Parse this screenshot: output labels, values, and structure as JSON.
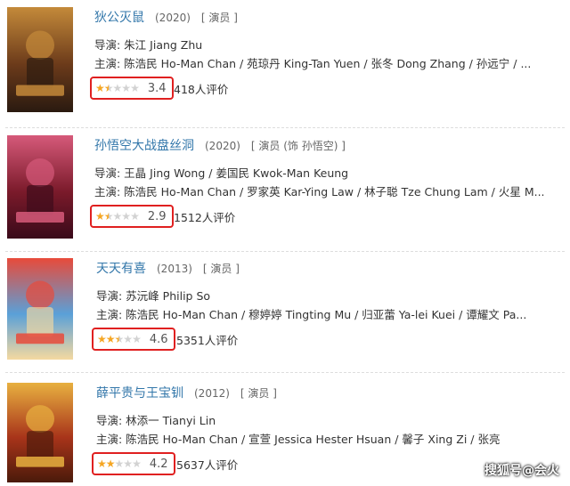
{
  "movies": [
    {
      "title": "狄公灭鼠",
      "year": "(2020)",
      "role": "[ 演员 ]",
      "director_line": "导演: 朱江 Jiang Zhu",
      "cast_line": "主演: 陈浩民 Ho-Man Chan / 苑琼丹 King-Tan Yuen / 张冬 Dong Zhang / 孙远宁 / ...",
      "score": "3.4",
      "rating_fraction": 0.34,
      "count": "418人评价",
      "poster_colors": [
        "#6b3a1a",
        "#c48a3a",
        "#2a1a10"
      ]
    },
    {
      "title": "孙悟空大战盘丝洞",
      "year": "(2020)",
      "role": "[ 演员 (饰 孙悟空) ]",
      "director_line": "导演: 王晶 Jing Wong / 姜国民 Kwok-Man Keung",
      "cast_line": "主演: 陈浩民 Ho-Man Chan / 罗家英 Kar-Ying Law / 林子聪 Tze Chung Lam / 火星 M...",
      "score": "2.9",
      "rating_fraction": 0.29,
      "count": "1512人评价",
      "poster_colors": [
        "#7a1a2a",
        "#d65a7a",
        "#3a0a1a"
      ]
    },
    {
      "title": "天天有喜",
      "year": "(2013)",
      "role": "[ 演员 ]",
      "director_line": "导演: 苏沅峰 Philip So",
      "cast_line": "主演: 陈浩民 Ho-Man Chan / 穆婷婷 Tingting Mu / 归亚蕾 Ya-lei Kuei / 谭耀文 Pa...",
      "score": "4.6",
      "rating_fraction": 0.46,
      "count": "5351人评价",
      "poster_colors": [
        "#5aa0d8",
        "#e84a3a",
        "#f5d9a0"
      ]
    },
    {
      "title": "薛平贵与王宝钏",
      "year": "(2012)",
      "role": "[ 演员 ]",
      "director_line": "导演: 林添一 Tianyi Lin",
      "cast_line": "主演: 陈浩民 Ho-Man Chan / 宣萱 Jessica Hester Hsuan / 馨子 Xing Zi / 张亮",
      "score": "4.2",
      "rating_fraction": 0.42,
      "count": "5637人评价",
      "poster_colors": [
        "#a8341a",
        "#e8b040",
        "#4a1a0a"
      ]
    }
  ],
  "watermark": "搜狐号@会火"
}
